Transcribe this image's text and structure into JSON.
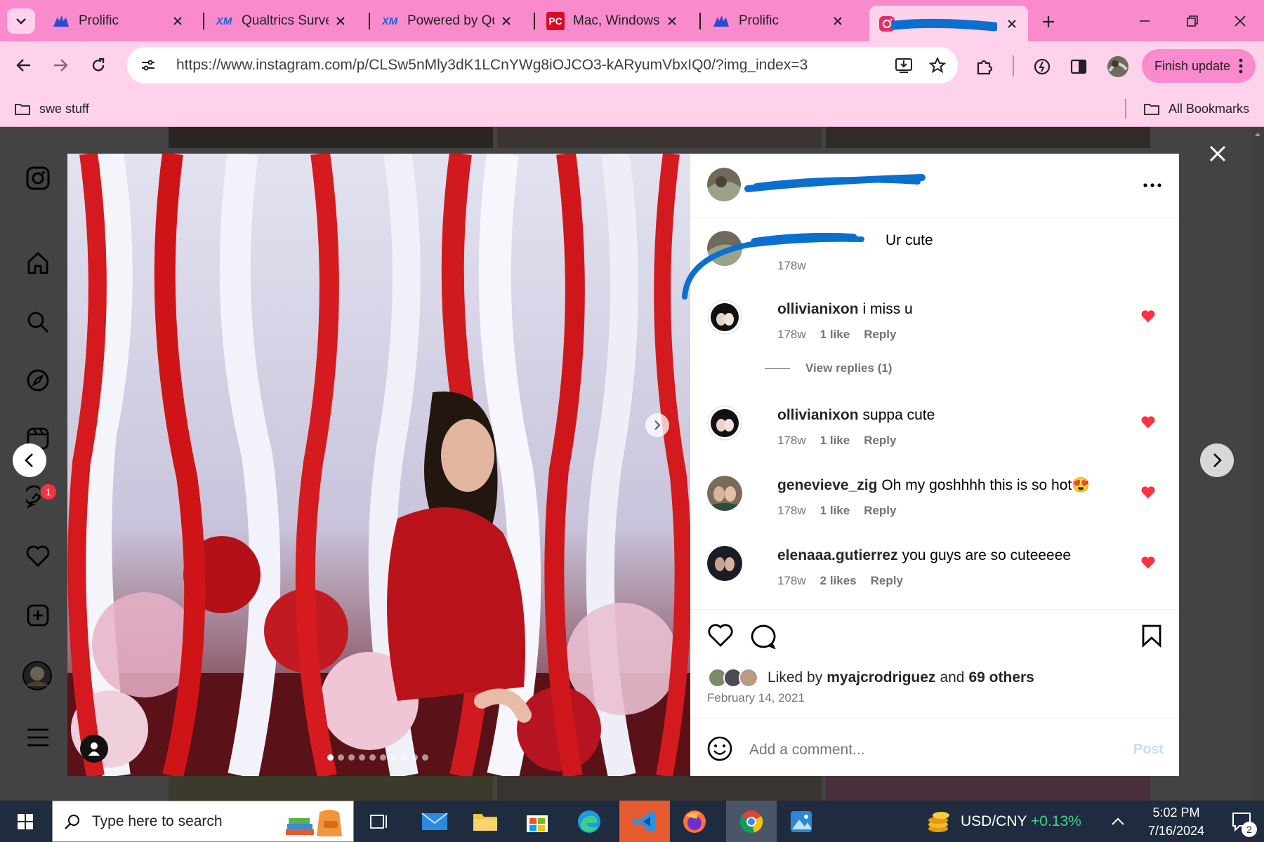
{
  "browser": {
    "tabs": [
      {
        "title": "Prolific",
        "favicon": "prolific-icon"
      },
      {
        "title": "Qualtrics Survey",
        "favicon": "qualtrics-icon"
      },
      {
        "title": "Powered by Qua",
        "favicon": "qualtrics-icon"
      },
      {
        "title": "Mac, Windows,",
        "favicon": "pcmag-icon"
      },
      {
        "title": "Prolific",
        "favicon": "prolific-icon"
      },
      {
        "title": "",
        "favicon": "instagram-icon",
        "active": true
      }
    ],
    "url": "https://www.instagram.com/p/CLSw5nMly3dK1LCnYWg8iOJCO3-kARyumVbxIQ0/?img_index=3",
    "finish_update_label": "Finish update",
    "bookmarks": {
      "folder": "swe stuff",
      "all": "All Bookmarks"
    }
  },
  "sidebar": {
    "items": [
      "instagram-logo-icon",
      "home-icon",
      "search-icon",
      "explore-icon",
      "reels-icon",
      "messages-icon",
      "notifications-heart-icon",
      "create-icon",
      "profile-avatar",
      "more-menu-icon"
    ],
    "messages_badge": "1"
  },
  "post": {
    "username_redacted": "",
    "image_dots_count": 10,
    "active_dot": 0,
    "comments": [
      {
        "user": "",
        "text": "Ur cute",
        "time": "178w",
        "likes": "",
        "reply": "",
        "redacted": true
      },
      {
        "user": "ollivianixon",
        "text": "i miss u",
        "time": "178w",
        "likes": "1 like",
        "reply": "Reply",
        "liked": true,
        "view_replies": "View replies (1)"
      },
      {
        "user": "ollivianixon",
        "text": "suppa cute",
        "time": "178w",
        "likes": "1 like",
        "reply": "Reply",
        "liked": true
      },
      {
        "user": "genevieve_zig",
        "text": "Oh my goshhhh this is so hot😍",
        "time": "178w",
        "likes": "1 like",
        "reply": "Reply",
        "liked": true
      },
      {
        "user": "elenaaa.gutierrez",
        "text": "you guys are so cuteeeee",
        "time": "178w",
        "likes": "2 likes",
        "reply": "Reply",
        "liked": true
      }
    ],
    "liked_by_prefix": "Liked by",
    "liked_by_user": "myajcrodriguez",
    "liked_by_and": "and",
    "liked_by_others": "69 others",
    "date": "February 14, 2021",
    "comment_placeholder": "Add a comment...",
    "post_label": "Post"
  },
  "taskbar": {
    "search_placeholder": "Type here to search",
    "currency_label": "USD/CNY",
    "currency_change": "+0.13%",
    "time": "5:02 PM",
    "date": "7/16/2024",
    "notification_count": "2"
  },
  "colors": {
    "tabbar": "#f98bcd",
    "toolbar": "#ffd2ec",
    "heart": "#ff3040",
    "backdrop": "#434343",
    "taskbar": "#1f2b3e",
    "redact": "#0b6fd0"
  }
}
